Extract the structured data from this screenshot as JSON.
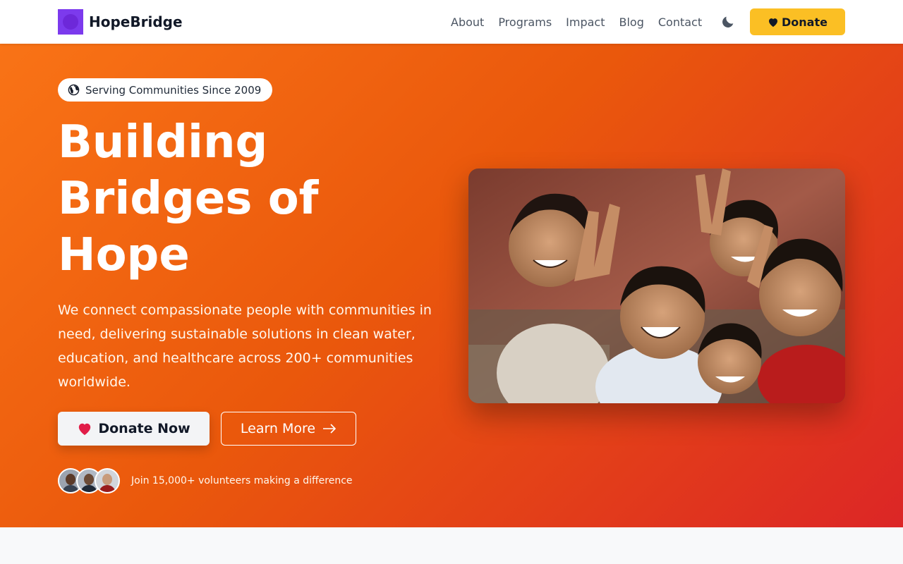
{
  "header": {
    "brand": "HopeBridge",
    "nav": [
      "About",
      "Programs",
      "Impact",
      "Blog",
      "Contact"
    ],
    "theme_toggle_icon": "moon-icon",
    "donate_label": "Donate",
    "donate_icon": "heart-icon"
  },
  "hero": {
    "badge": {
      "icon": "globe-icon",
      "text": "Serving Communities Since 2009"
    },
    "headline_lines": [
      "Building",
      "Bridges of",
      "Hope"
    ],
    "lead": "We connect compassionate people with communities in need, delivering sustainable solutions in clean water, education, and healthcare across 200+ communities worldwide.",
    "primary_button": {
      "icon": "heart-icon",
      "label": "Donate Now"
    },
    "secondary_button": {
      "label": "Learn More",
      "icon": "arrow-right-icon"
    },
    "volunteers_text": "Join 15,000+ volunteers making a difference"
  },
  "colors": {
    "brand_purple": "#7c3aed",
    "donate_yellow": "#fbbf24",
    "hero_gradient_start": "#f97316",
    "hero_gradient_end": "#dc2626",
    "heart_red": "#e11d48"
  }
}
